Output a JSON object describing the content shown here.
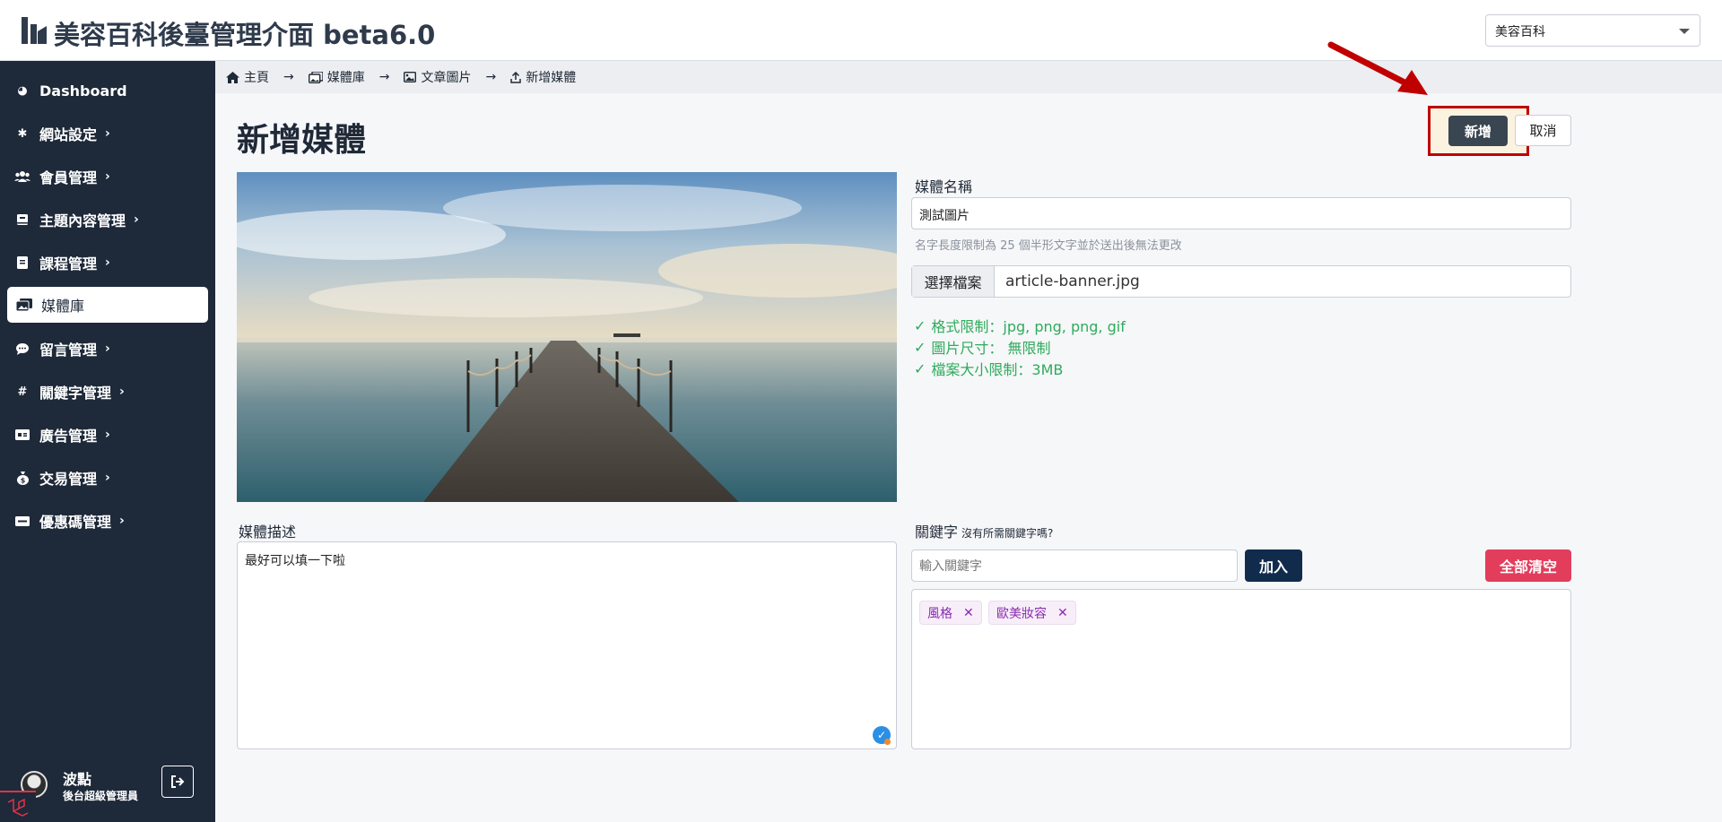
{
  "header": {
    "title": "美容百科後臺管理介面 beta6.0",
    "site_select": "美容百科"
  },
  "sidebar": {
    "items": [
      {
        "label": "Dashboard",
        "icon": "palette-icon"
      },
      {
        "label": "網站設定",
        "icon": "gear-icon"
      },
      {
        "label": "會員管理",
        "icon": "users-icon"
      },
      {
        "label": "主題內容管理",
        "icon": "book-icon"
      },
      {
        "label": "課程管理",
        "icon": "list-icon"
      },
      {
        "label": "媒體庫",
        "icon": "images-icon"
      },
      {
        "label": "留言管理",
        "icon": "comment-icon"
      },
      {
        "label": "關鍵字管理",
        "icon": "hash-icon"
      },
      {
        "label": "廣告管理",
        "icon": "ad-icon"
      },
      {
        "label": "交易管理",
        "icon": "money-bag-icon"
      },
      {
        "label": "優惠碼管理",
        "icon": "ticket-icon"
      }
    ],
    "active_index": 5,
    "user": {
      "name": "波點",
      "role": "後台超級管理員"
    }
  },
  "breadcrumb": [
    "主頁",
    "媒體庫",
    "文章圖片",
    "新增媒體"
  ],
  "main": {
    "page_title": "新增媒體",
    "add_button": "新增",
    "cancel_button": "取消",
    "media_name_label": "媒體名稱",
    "media_name_value": "測試圖片",
    "name_hint": "名字長度限制為 25 個半形文字並於送出後無法更改",
    "file_button": "選擇檔案",
    "file_name": "article-banner.jpg",
    "rules": [
      "格式限制：jpg, png, png, gif",
      "圖片尺寸： 無限制",
      "檔案大小限制：3MB"
    ],
    "description_label": "媒體描述",
    "description_value": "最好可以填一下啦",
    "keyword_label": "關鍵字",
    "keyword_hint": "沒有所需關鍵字嗎?",
    "keyword_placeholder": "輸入關鍵字",
    "join_button": "加入",
    "clear_button": "全部清空",
    "tags": [
      "風格",
      "歐美妝容"
    ]
  },
  "colors": {
    "sidebar_bg": "#1e2939",
    "add_button": "#394550",
    "join_button": "#112b4d",
    "clear_button": "#e33d5c",
    "rule_text": "#2eab5c",
    "tag_text": "#8a2bb0",
    "annotation_red": "#c00000"
  }
}
